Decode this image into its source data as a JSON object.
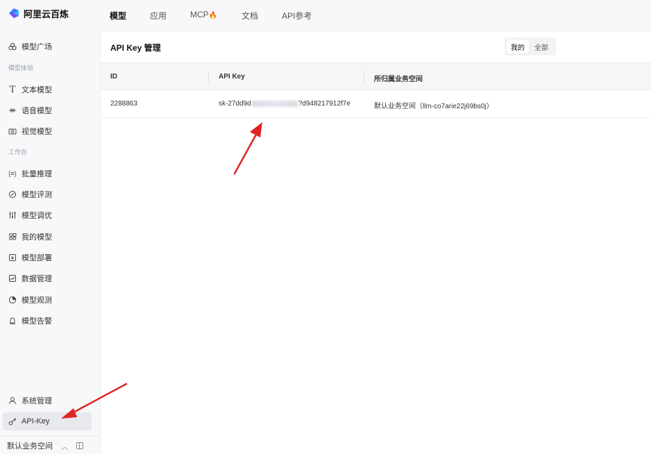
{
  "app": {
    "brand": "阿里云百炼"
  },
  "topnav": {
    "tabs": [
      {
        "label": "模型",
        "active": true
      },
      {
        "label": "应用"
      },
      {
        "label": "MCP"
      },
      {
        "label": "文档"
      },
      {
        "label": "API参考"
      }
    ]
  },
  "sidebar": {
    "plaza": "模型广场",
    "section_experience": "模型体验",
    "text_model": "文本模型",
    "speech_model": "语音模型",
    "vision_model": "视觉模型",
    "section_workbench": "工作台",
    "batch_inference": "批量推理",
    "model_eval": "模型评测",
    "model_tuning": "模型调优",
    "my_models": "我的模型",
    "model_deploy": "模型部署",
    "data_manage": "数据管理",
    "model_observe": "模型观测",
    "model_alert": "模型告警",
    "system_manage": "系统管理",
    "api_key": "API-Key",
    "workspace": "默认业务空间"
  },
  "panel": {
    "title": "API Key 管理",
    "filter": {
      "mine": "我的",
      "all": "全部",
      "selected": "我的"
    }
  },
  "table": {
    "columns": [
      "ID",
      "API Key",
      "所归属业务空间"
    ],
    "rows": [
      {
        "id": "2288863",
        "key_prefix": "sk-27dd9d",
        "key_suffix": "?d948217912f7e",
        "workspace": "默认业务空间（llm-co7arie22j69bs0j）"
      }
    ]
  },
  "colors": {
    "arrow": "#e02424",
    "accent_fire": "#ff8a00",
    "active_nav": "#e8e9ed"
  }
}
